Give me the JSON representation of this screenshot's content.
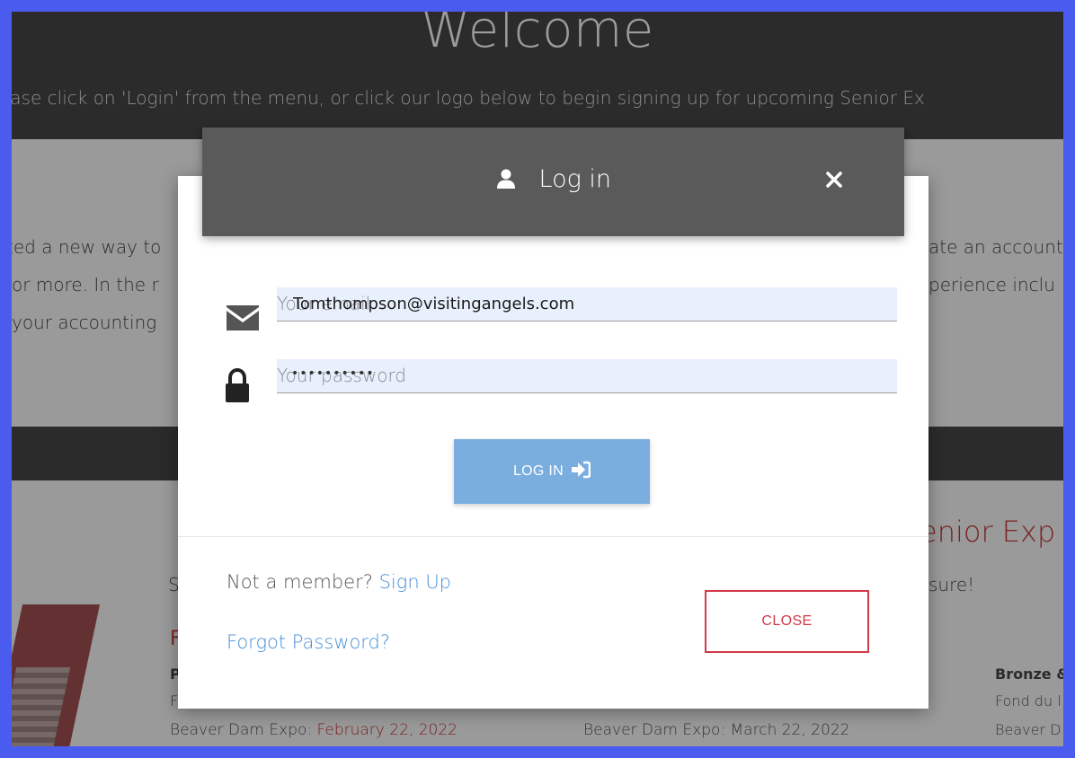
{
  "background": {
    "hero_title": "Welcome",
    "hero_subtitle": "ease click on 'Login' from the menu, or click our logo below to begin signing up for upcoming Senior Ex",
    "left_lines": [
      "ted a new way to",
      "or more. In the r",
      "your accounting"
    ],
    "right_lines": [
      "ate an account",
      "perience inclu"
    ],
    "right_heading": "enior Exp",
    "left_s": "S",
    "right_sure": "sure!",
    "left_heading_initial": "F",
    "left_bold_initial": "P",
    "left_line_initial": "F",
    "col1_date_label": "Beaver Dam Expo: ",
    "col1_date_value": "February 22, 2022",
    "col2_date_label": "Beaver Dam Expo: March 22, 2022",
    "col3_heading": "Bronze &",
    "col3_line1": "Fond du l",
    "col3_line2": "Beaver D"
  },
  "modal": {
    "title": "Log in",
    "email": {
      "placeholder": "Your email",
      "value": "Tomthompson@visitingangels.com"
    },
    "password": {
      "placeholder": "Your password",
      "masked_value": "••••••••••"
    },
    "login_button_label": "LOG IN",
    "not_member_text": "Not a member? ",
    "signup_link": "Sign Up",
    "forgot_link": "Forgot Password?",
    "close_button_label": "CLOSE"
  },
  "colors": {
    "header_bg": "#5a5a5a",
    "login_button": "#7aaedf",
    "close_button_border": "#d13a4a",
    "link": "#4a8fd8",
    "input_bg": "#e8f0fe"
  }
}
